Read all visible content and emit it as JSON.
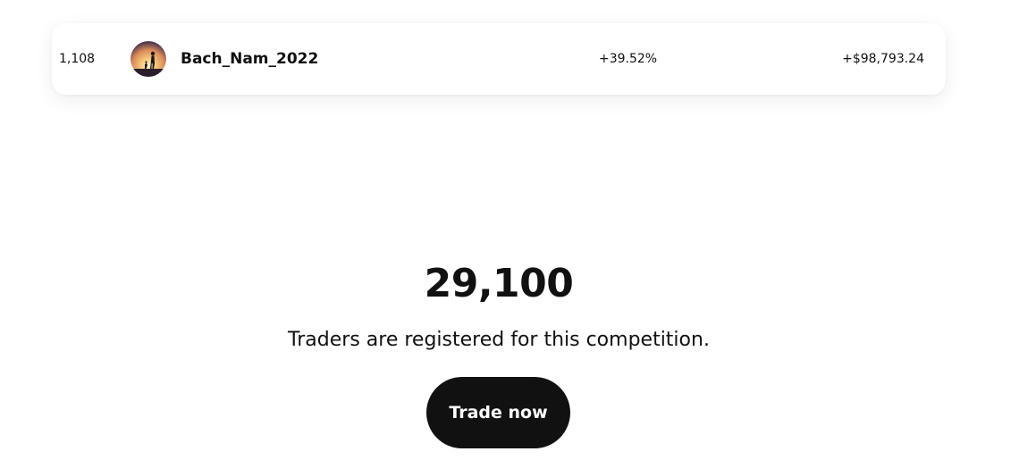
{
  "leaderboard_row": {
    "rank": "1,108",
    "avatar_icon": "sunset-silhouette-avatar",
    "username": "Bach_Nam_2022",
    "roi": "+39.52%",
    "pnl": "+$98,793.24"
  },
  "registration": {
    "count": "29,100",
    "description": "Traders are registered for this competition.",
    "cta_label": "Trade now"
  },
  "colors": {
    "text": "#111111",
    "button_bg": "#111111",
    "button_text": "#ffffff",
    "card_bg": "#ffffff"
  }
}
